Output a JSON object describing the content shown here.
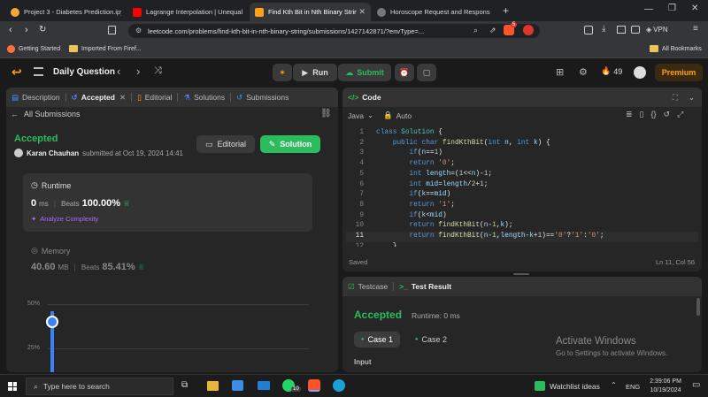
{
  "browser": {
    "tabs": [
      {
        "label": "Project 3 - Diabetes Prediction.ipynb",
        "color": "#f4a63b"
      },
      {
        "label": "Lagrange Interpolation | Unequal Int",
        "color": "#ff0000"
      },
      {
        "label": "Find Kth Bit in Nth Binary String",
        "color": "#ffa116"
      },
      {
        "label": "Horoscope Request and Response",
        "color": "#888888"
      }
    ],
    "url": "leetcode.com/problems/find-kth-bit-in-nth-binary-string/submissions/1427142871/?envType=...",
    "vpn": "VPN",
    "brave_badge": "5",
    "bookmarks": [
      "Getting Started",
      "Imported From Firef..."
    ],
    "all_bookmarks": "All Bookmarks"
  },
  "header": {
    "title": "Daily Question",
    "run": "Run",
    "submit": "Submit",
    "streak": "49",
    "premium": "Premium"
  },
  "left": {
    "tabs": [
      "Description",
      "Accepted",
      "Editorial",
      "Solutions",
      "Submissions"
    ],
    "back": "All Submissions",
    "status": "Accepted",
    "user": "Karan Chauhan",
    "submitted": "submitted at Oct 19, 2024 14:41",
    "editorial_btn": "Editorial",
    "solution_btn": "Solution",
    "runtime_label": "Runtime",
    "runtime_value": "0",
    "runtime_unit": "ms",
    "beats_label": "Beats",
    "runtime_beats": "100.00%",
    "analyze": "Analyze Complexity",
    "memory_label": "Memory",
    "memory_value": "40.60",
    "memory_unit": "MB",
    "memory_beats": "85.41%",
    "chart_ticks": [
      "50%",
      "25%"
    ]
  },
  "code": {
    "title": "Code",
    "language": "Java",
    "auto": "Auto",
    "line_numbers": [
      "1",
      "2",
      "3",
      "4",
      "5",
      "6",
      "7",
      "8",
      "9",
      "10",
      "11",
      "12"
    ],
    "saved": "Saved",
    "cursor": "Ln 11, Col 56"
  },
  "result": {
    "testcase_tab": "Testcase",
    "result_tab": "Test Result",
    "status": "Accepted",
    "runtime": "Runtime: 0 ms",
    "cases": [
      "Case 1",
      "Case 2"
    ],
    "input": "Input",
    "watermark_title": "Activate Windows",
    "watermark_sub": "Go to Settings to activate Windows."
  },
  "taskbar": {
    "search": "Type here to search",
    "weather": "Watchlist ideas",
    "lang": "ENG",
    "time": "2:39:06 PM",
    "date": "10/19/2024",
    "badge": "10"
  }
}
